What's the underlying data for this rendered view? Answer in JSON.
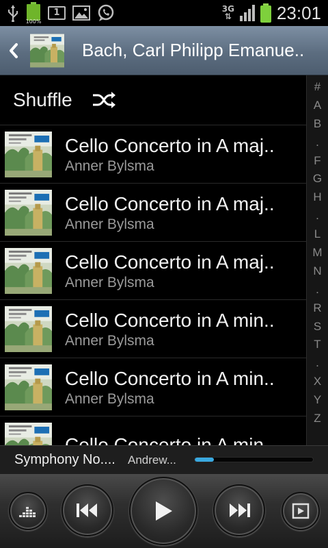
{
  "status_bar": {
    "icons": [
      "usb-icon",
      "battery-icon",
      "calendar-icon",
      "gallery-icon",
      "whatsapp-icon"
    ],
    "battery_percent": "100%",
    "calendar_day": "1",
    "network": "3G",
    "time": "23:01"
  },
  "header": {
    "title": "Bach, Carl Philipp Emanue.."
  },
  "shuffle": {
    "label": "Shuffle"
  },
  "tracks": [
    {
      "title": "Cello Concerto in A maj..",
      "artist": "Anner Bylsma"
    },
    {
      "title": "Cello Concerto in A maj..",
      "artist": "Anner Bylsma"
    },
    {
      "title": "Cello Concerto in A maj..",
      "artist": "Anner Bylsma"
    },
    {
      "title": "Cello Concerto in A min..",
      "artist": "Anner Bylsma"
    },
    {
      "title": "Cello Concerto in A min..",
      "artist": "Anner Bylsma"
    },
    {
      "title": "Cello Concerto in A min..",
      "artist": ""
    }
  ],
  "index": [
    "#",
    "A",
    "B",
    ".",
    "F",
    "G",
    "H",
    ".",
    "L",
    "M",
    "N",
    ".",
    "R",
    "S",
    "T",
    ".",
    "X",
    "Y",
    "Z"
  ],
  "now_playing": {
    "title": "Symphony No....",
    "artist": "Andrew...",
    "progress": 0.16
  },
  "colors": {
    "accent": "#3aa9e0",
    "header": "#6a7b8e",
    "battery": "#7ed03c"
  }
}
